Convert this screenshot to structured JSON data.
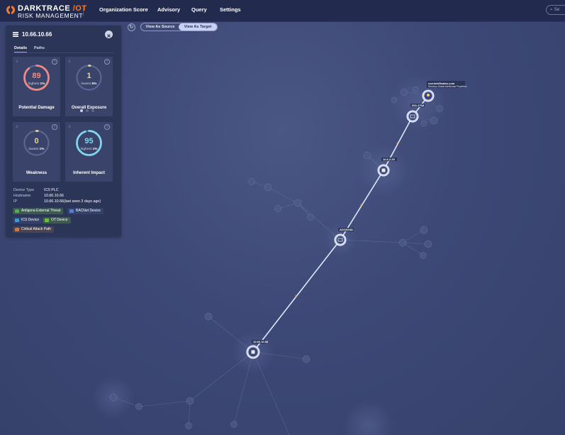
{
  "header": {
    "logo_brand": "DARKTRACE",
    "logo_suffix": "/OT",
    "logo_subtitle": "RISK MANAGEMENT",
    "nav": [
      "Organization Score",
      "Advisory",
      "Query",
      "Settings"
    ],
    "search_placeholder": "Se"
  },
  "panel": {
    "title": "10.66.10.66",
    "tabs": [
      "Details",
      "Paths"
    ],
    "cards": [
      {
        "value": "89",
        "sub_prefix": "highest",
        "sub_value": "1%",
        "title": "Potential Damage",
        "color": "#ef8a86",
        "fill": 0.89
      },
      {
        "value": "1",
        "sub_prefix": "lowest",
        "sub_value": "5%",
        "title": "Overall Exposure",
        "color": "#f2d27a",
        "fill": 0.01
      },
      {
        "value": "0",
        "sub_prefix": "lowest",
        "sub_value": "1%",
        "title": "Weakness",
        "color": "#f2d27a",
        "fill": 0.0
      },
      {
        "value": "95",
        "sub_prefix": "highest",
        "sub_value": "1%",
        "title": "Inherent Impact",
        "color": "#7fd6ee",
        "fill": 0.95
      }
    ],
    "info": [
      {
        "key": "Device Type",
        "value": "ICS PLC"
      },
      {
        "key": "Hostname",
        "value": "10.66.10.66"
      },
      {
        "key": "IP",
        "value": "10.66.10.66(last seen 3 days ago)"
      }
    ],
    "tags": [
      {
        "label": "Antigena External Threat",
        "color": "#4caf50"
      },
      {
        "label": "BACNet Device",
        "color": "#4f7fd6"
      },
      {
        "label": "ICS Device",
        "color": "#3a9ad9"
      },
      {
        "label": "OT Device",
        "color": "#6cbf3b"
      },
      {
        "label": "Critical Attack Path",
        "color": "#d9763a"
      }
    ]
  },
  "controls": {
    "view_source": "View As Source",
    "view_target": "View As Target"
  },
  "graph": {
    "node_labels": {
      "top_name": "corrintrificates.com",
      "top_sub": "Directory Global Intellectual Properties",
      "n1": "ISO-2768",
      "n2": "10.6.2.25",
      "n3": "ADOS04D",
      "n4": "10.66.10.66"
    }
  }
}
